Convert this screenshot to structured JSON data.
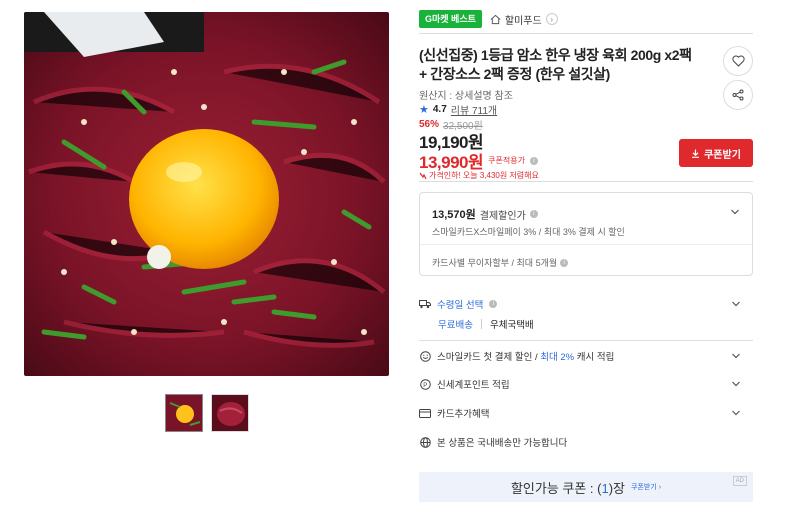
{
  "colors": {
    "accent_red": "#e0292d",
    "accent_blue": "#2c6bd8",
    "badge_green": "#19b23a"
  },
  "gallery": {
    "main_image": "yukhoe-raw-beef-with-egg-yolk",
    "thumbnails": [
      "yukhoe-with-yolk-thumb",
      "raw-beef-thumb"
    ]
  },
  "header": {
    "badge": "G마켓 베스트",
    "store_name": "할미푸드",
    "store_icon": "home-icon",
    "store_arrow": "›"
  },
  "product": {
    "title": "(신선집중) 1등급 암소 한우 냉장 육회 200g x2팩 + 간장소스 2팩 증정 (한우 설깃살)",
    "origin": "원산지 : 상세설명 참조",
    "rating": "4.7",
    "review_label": "리뷰 711개",
    "discount_rate": "56%",
    "original_price": "32,500원",
    "sale_price": "19,190원",
    "coupon_price": "13,990원",
    "coupon_applied_label": "쿠폰적용가",
    "price_drop_note": "가격인하! 오늘 3,430원 저렴해요",
    "coupon_button": "쿠폰받기"
  },
  "payment": {
    "amount": "13,570원",
    "amount_label": "결제할인가",
    "detail": "스마일카드X스마일페이 3% / 최대 3% 결제 시 할인",
    "installment": "카드사별 무이자할부 / 최대 5개월"
  },
  "shipping": {
    "label": "수령일 선택",
    "free": "무료배송",
    "carrier": "우체국택배"
  },
  "benefits": [
    {
      "icon": "smile-icon",
      "prefix": "스마일카드 첫 결제 할인 / ",
      "highlight": "최대 2%",
      "suffix": " 캐시 적립"
    },
    {
      "icon": "point-icon",
      "prefix": "신세계포인트 적립",
      "highlight": "",
      "suffix": ""
    },
    {
      "icon": "card-icon",
      "prefix": "카드추가혜택",
      "highlight": "",
      "suffix": ""
    },
    {
      "icon": "globe-icon",
      "prefix": "본 상품은 국내배송만 가능합니다",
      "highlight": "",
      "suffix": ""
    }
  ],
  "coupon_banner": {
    "prefix": "할인가능 쿠폰 : (",
    "count": "1",
    "suffix": ")장",
    "link": "쿠폰받기 ›",
    "ad": "AD"
  }
}
